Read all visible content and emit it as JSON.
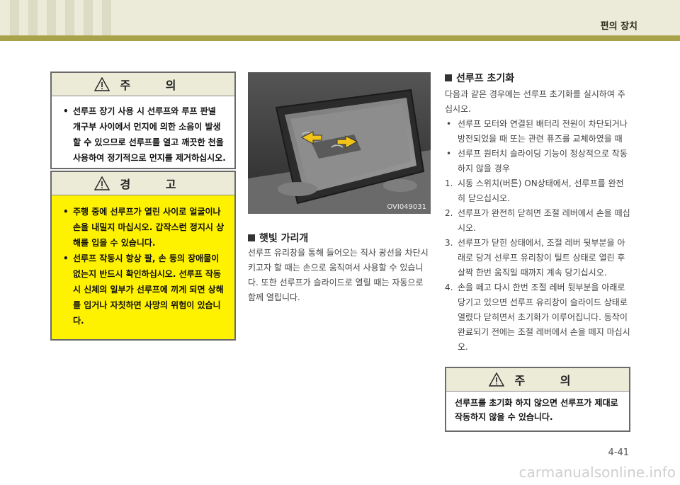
{
  "header": {
    "title": "편의 장치"
  },
  "caution_box_1": {
    "title": "주  의",
    "items": [
      "선루프 장기 사용 시 선루프와 루프 판넬 개구부 사이에서 먼지에 의한 소음이 발생할 수 있으므로 선루프를 열고 깨끗한 천을 사용하여 정기적으로 먼지를 제거하십시오."
    ]
  },
  "warning_box": {
    "title": "경  고",
    "items": [
      "주행 중에 선루프가 열린 사이로 얼굴이나 손을 내밀지 마십시오. 갑작스런 정지시 상해를 입을 수 있습니다.",
      "선루프 작동시 항상 팔, 손 등의 장애물이 없는지 반드시 확인하십시오. 선루프 작동시 신체의 일부가 선루프에 끼게 되면 상해를 입거나 자칫하면 사망의 위험이 있습니다."
    ]
  },
  "photo": {
    "code": "OVI049031"
  },
  "sunshade": {
    "title": "햇빛 가리개",
    "text": "선루프 유리창을 통해 들어오는 직사 광선을 차단시키고자 할 때는 손으로 움직여서 사용할 수 있습니다. 또한 선루프가 슬라이드로 열릴 때는 자동으로 함께 열립니다."
  },
  "reset": {
    "title": "선루프 초기화",
    "intro": "다음과 같은 경우에는 선루프 초기화를 실시하여 주십시오.",
    "conditions": [
      "선루프 모터와 연결된 배터리 전원이 차단되거나 방전되었을 때 또는 관련 퓨즈를 교체하였을 때",
      "선루프 원터치 슬라이딩 기능이 정상적으로 작동하지 않을 경우"
    ],
    "steps": [
      {
        "n": "1.",
        "text": "시동 스위치(버튼) ON상태에서, 선루프를 완전히 닫으십시오."
      },
      {
        "n": "2.",
        "text": "선루프가 완전히 닫히면 조절 레버에서 손을 떼십시오."
      },
      {
        "n": "3.",
        "text": "선루프가 닫힌 상태에서, 조절 레버 뒷부분을 아래로 당겨 선루프 유리창이 틸트 상태로 열린 후 살짝 한번 움직일 때까지 계속 당기십시오."
      },
      {
        "n": "4.",
        "text": "손을 떼고 다시 한번 조절 레버 뒷부분을 아래로 당기고 있으면 선루프 유리창이 슬라이드 상태로 열렸다 닫히면서 초기화가 이루어집니다. 동작이 완료되기 전에는 조절 레버에서 손을 떼지 마십시오."
      }
    ]
  },
  "caution_box_2": {
    "title": "주  의",
    "text": "선루프를 초기화 하지 않으면 선루프가 제대로 작동하지 않을 수 있습니다."
  },
  "footer": {
    "page": "4-41",
    "watermark": "carmanualsonline.info"
  }
}
